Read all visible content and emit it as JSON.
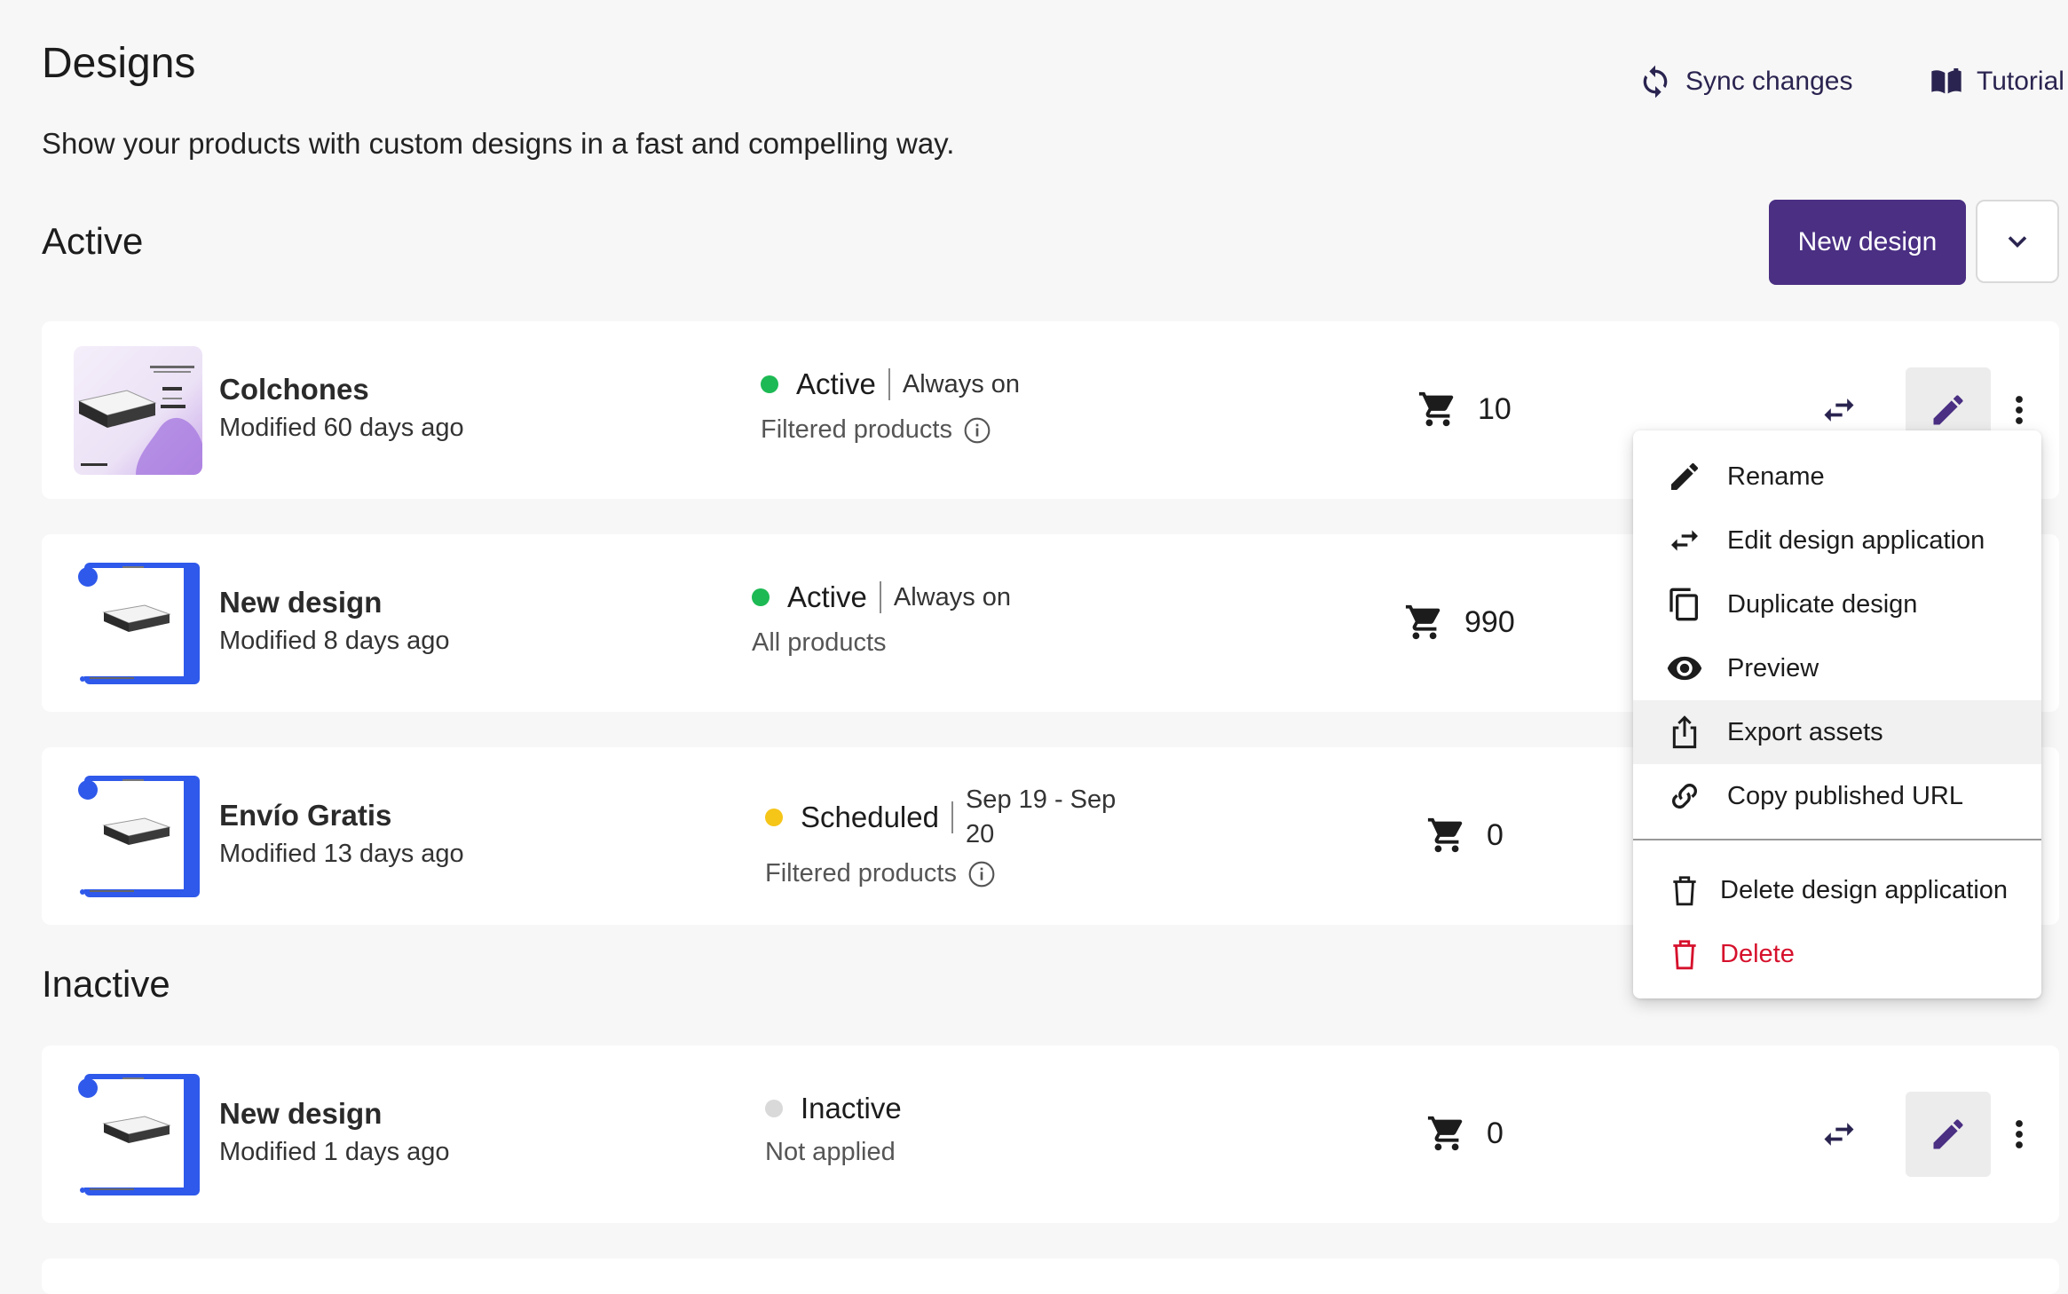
{
  "header": {
    "title": "Designs",
    "subtitle": "Show your products with custom designs in a fast and compelling way.",
    "sync_label": "Sync changes",
    "tutorial_label": "Tutorial"
  },
  "sections": {
    "active_title": "Active",
    "inactive_title": "Inactive"
  },
  "toolbar": {
    "new_design_label": "New design"
  },
  "designs": [
    {
      "name": "Colchones",
      "modified": "Modified 60 days ago",
      "status": "Active",
      "schedule": "Always on",
      "products": "Filtered products",
      "count": "10",
      "dot_color": "#1db954"
    },
    {
      "name": "New design",
      "modified": "Modified 8 days ago",
      "status": "Active",
      "schedule": "Always on",
      "products": "All products",
      "count": "990",
      "dot_color": "#1db954"
    },
    {
      "name": "Envío Gratis",
      "modified": "Modified 13 days ago",
      "status": "Scheduled",
      "schedule_line1": "Sep 19 - Sep",
      "schedule_line2": "20",
      "products": "Filtered products",
      "count": "0",
      "dot_color": "#f5c518"
    },
    {
      "name": "New design",
      "modified": "Modified 1 days ago",
      "status": "Inactive",
      "products": "Not applied",
      "count": "0",
      "dot_color": "#d9d9d9"
    }
  ],
  "menu": {
    "items": [
      {
        "label": "Rename",
        "icon": "pencil-icon"
      },
      {
        "label": "Edit design application",
        "icon": "swap-icon"
      },
      {
        "label": "Duplicate design",
        "icon": "copy-icon"
      },
      {
        "label": "Preview",
        "icon": "eye-icon"
      },
      {
        "label": "Export assets",
        "icon": "share-icon"
      },
      {
        "label": "Copy published URL",
        "icon": "link-icon"
      },
      {
        "label": "Delete design application",
        "icon": "trash-icon"
      },
      {
        "label": "Delete",
        "icon": "trash-red-icon"
      }
    ],
    "danger_color": "#d6112c"
  },
  "colors": {
    "accent": "#4a2f83",
    "icon_dark": "#2a2450"
  }
}
